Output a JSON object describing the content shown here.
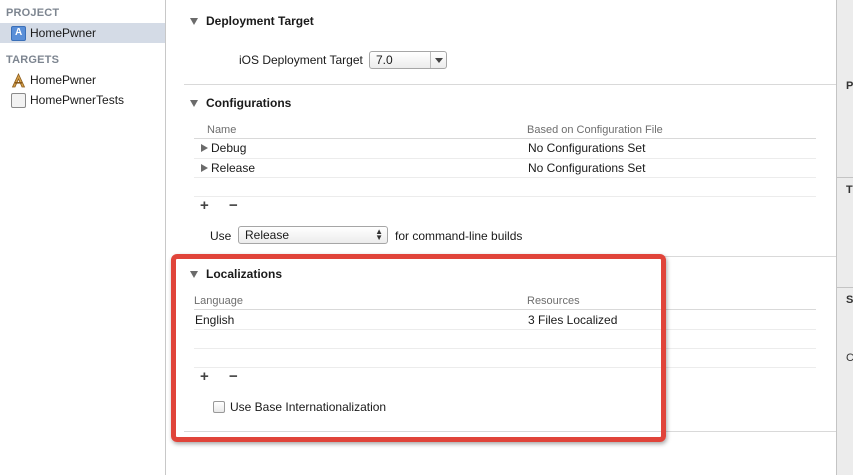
{
  "sidebar": {
    "project_header": "PROJECT",
    "project_item": "HomePwner",
    "targets_header": "TARGETS",
    "targets": [
      "HomePwner",
      "HomePwnerTests"
    ]
  },
  "deployment": {
    "title": "Deployment Target",
    "label": "iOS Deployment Target",
    "value": "7.0"
  },
  "configurations": {
    "title": "Configurations",
    "col_name": "Name",
    "col_based": "Based on Configuration File",
    "rows": [
      {
        "name": "Debug",
        "based": "No Configurations Set"
      },
      {
        "name": "Release",
        "based": "No Configurations Set"
      }
    ],
    "add": "+",
    "remove": "−",
    "use_label": "Use",
    "use_value": "Release",
    "use_suffix": "for command-line builds"
  },
  "localizations": {
    "title": "Localizations",
    "col_language": "Language",
    "col_resources": "Resources",
    "rows": [
      {
        "language": "English",
        "resources": "3 Files Localized"
      }
    ],
    "add": "+",
    "remove": "−",
    "base_label": "Use Base Internationalization"
  },
  "inspector": {
    "letters": [
      "P",
      "T",
      "S",
      "C"
    ]
  },
  "colors": {
    "highlight": "#e0443a",
    "selection": "#d4dbe6"
  }
}
